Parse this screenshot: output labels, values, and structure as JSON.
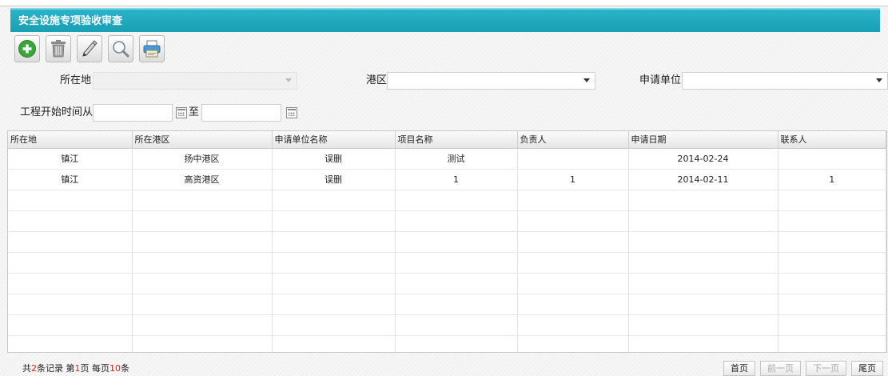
{
  "title": "安全设施专项验收审查",
  "toolbar": [
    {
      "name": "add-icon"
    },
    {
      "name": "delete-icon"
    },
    {
      "name": "edit-icon"
    },
    {
      "name": "search-icon"
    },
    {
      "name": "print-icon"
    }
  ],
  "filters": {
    "location_label": "所在地",
    "location_value": "",
    "port_label": "港区",
    "port_value": "",
    "applicant_label": "申请单位",
    "applicant_value": "",
    "start_from_label": "工程开始时间从",
    "start_from_value": "",
    "to_label": "至",
    "to_value": ""
  },
  "table": {
    "columns": [
      "所在地",
      "所在港区",
      "申请单位名称",
      "项目名称",
      "负责人",
      "申请日期",
      "联系人"
    ],
    "rows": [
      [
        "镇江",
        "扬中港区",
        "误删",
        "测试",
        "",
        "2014-02-24",
        ""
      ],
      [
        "镇江",
        "高资港区",
        "误删",
        "1",
        "1",
        "2014-02-11",
        "1"
      ]
    ],
    "empty_rows": 8
  },
  "footer": {
    "prefix": "共",
    "total": "2",
    "records_text": "条记录 第",
    "page": "1",
    "page_text": "页 每页",
    "per_page": "10",
    "per_page_text": "条",
    "first_label": "首页",
    "prev_label": "前一页",
    "next_label": "下一页",
    "last_label": "尾页"
  },
  "colors": {
    "titlebar": "#1fa8bd",
    "accent_red": "#e0201b",
    "add_green": "#3aa53a"
  }
}
